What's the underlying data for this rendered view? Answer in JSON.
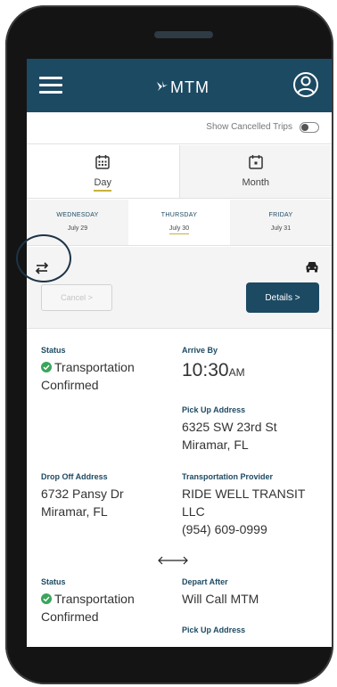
{
  "header": {
    "logo_text": "MTM"
  },
  "cancelled_toggle": {
    "label": "Show Cancelled Trips",
    "checked": false
  },
  "view_tabs": [
    {
      "label": "Day",
      "icon": "calendar-grid-icon",
      "active": true
    },
    {
      "label": "Month",
      "icon": "calendar-dot-icon",
      "active": false
    }
  ],
  "days": [
    {
      "name": "WEDNESDAY",
      "date": "July 29",
      "active": false
    },
    {
      "name": "THURSDAY",
      "date": "July 30",
      "active": true
    },
    {
      "name": "FRIDAY",
      "date": "July 31",
      "active": false
    }
  ],
  "actions": {
    "cancel_label": "Cancel >",
    "details_label": "Details >"
  },
  "trip1": {
    "status_label": "Status",
    "status_line1": "Transportation",
    "status_line2": "Confirmed",
    "arrive_by_label": "Arrive By",
    "arrive_time": "10:30",
    "arrive_ampm": "AM",
    "pickup_label": "Pick Up Address",
    "pickup_line1": "6325 SW 23rd St",
    "pickup_line2": "Miramar, FL",
    "dropoff_label": "Drop Off Address",
    "dropoff_line1": "6732 Pansy Dr",
    "dropoff_line2": "Miramar, FL",
    "provider_label": "Transportation Provider",
    "provider_line1": "RIDE WELL TRANSIT",
    "provider_line2": "LLC",
    "provider_phone": "(954) 609-0999"
  },
  "trip2": {
    "status_label": "Status",
    "status_line1": "Transportation",
    "status_line2": "Confirmed",
    "depart_after_label": "Depart After",
    "depart_after_value": "Will Call MTM",
    "pickup_label": "Pick Up Address"
  },
  "colors": {
    "brand": "#1d4a63",
    "accent_underline": "#c8b23a",
    "status_green": "#3aa55b"
  }
}
